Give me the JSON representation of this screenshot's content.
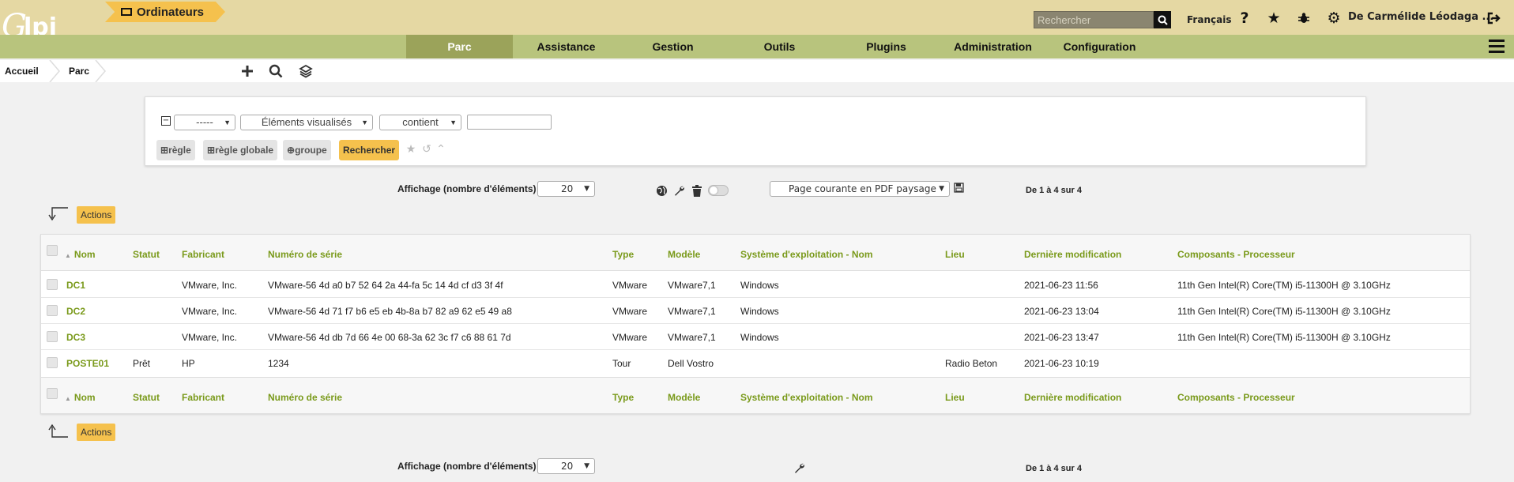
{
  "header": {
    "logo_text": "Glpi",
    "search_placeholder": "Rechercher",
    "language": "Français",
    "user": "De Carmélide Léodaga ..."
  },
  "menu": {
    "items": [
      "Parc",
      "Assistance",
      "Gestion",
      "Outils",
      "Plugins",
      "Administration",
      "Configuration"
    ],
    "active": "Parc"
  },
  "breadcrumb": {
    "home": "Accueil",
    "section": "Parc",
    "current": "Ordinateurs"
  },
  "criteria": {
    "field1": "-----",
    "field2": "Éléments visualisés",
    "operator": "contient",
    "value": "",
    "rule_btn": "règle",
    "global_rule_btn": "règle globale",
    "group_btn": "groupe",
    "search_btn": "Rechercher"
  },
  "pager": {
    "display_label": "Affichage (nombre d'éléments)",
    "display_value": "20",
    "export_option": "Page courante en PDF paysage",
    "count": "De 1 à 4 sur 4"
  },
  "actions_label": "Actions",
  "table": {
    "columns": [
      "Nom",
      "Statut",
      "Fabricant",
      "Numéro de série",
      "Type",
      "Modèle",
      "Système d'exploitation - Nom",
      "Lieu",
      "Dernière modification",
      "Composants - Processeur"
    ],
    "rows": [
      {
        "nom": "DC1",
        "statut": "",
        "fabricant": "VMware, Inc.",
        "serie": "VMware-56 4d a0 b7 52 64 2a 44-fa 5c 14 4d cf d3 3f 4f",
        "type": "VMware",
        "modele": "VMware7,1",
        "os": "Windows",
        "lieu": "",
        "modif": "2021-06-23 11:56",
        "cpu": "11th Gen Intel(R) Core(TM) i5-11300H @ 3.10GHz"
      },
      {
        "nom": "DC2",
        "statut": "",
        "fabricant": "VMware, Inc.",
        "serie": "VMware-56 4d 71 f7 b6 e5 eb 4b-8a b7 82 a9 62 e5 49 a8",
        "type": "VMware",
        "modele": "VMware7,1",
        "os": "Windows",
        "lieu": "",
        "modif": "2021-06-23 13:04",
        "cpu": "11th Gen Intel(R) Core(TM) i5-11300H @ 3.10GHz"
      },
      {
        "nom": "DC3",
        "statut": "",
        "fabricant": "VMware, Inc.",
        "serie": "VMware-56 4d db 7d 66 4e 00 68-3a 62 3c f7 c6 88 61 7d",
        "type": "VMware",
        "modele": "VMware7,1",
        "os": "Windows",
        "lieu": "",
        "modif": "2021-06-23 13:47",
        "cpu": "11th Gen Intel(R) Core(TM) i5-11300H @ 3.10GHz"
      },
      {
        "nom": "POSTE01",
        "statut": "Prêt",
        "fabricant": "HP",
        "serie": "1234",
        "type": "Tour",
        "modele": "Dell Vostro",
        "os": "",
        "lieu": "Radio Beton",
        "modif": "2021-06-23 10:19",
        "cpu": ""
      }
    ]
  },
  "colors": {
    "header_bg": "#e5d8a3",
    "menu_bg": "#b8c47d",
    "menu_active": "#9ba35a",
    "accent_yellow": "#f5c14d",
    "link_green": "#7a9a1b"
  }
}
